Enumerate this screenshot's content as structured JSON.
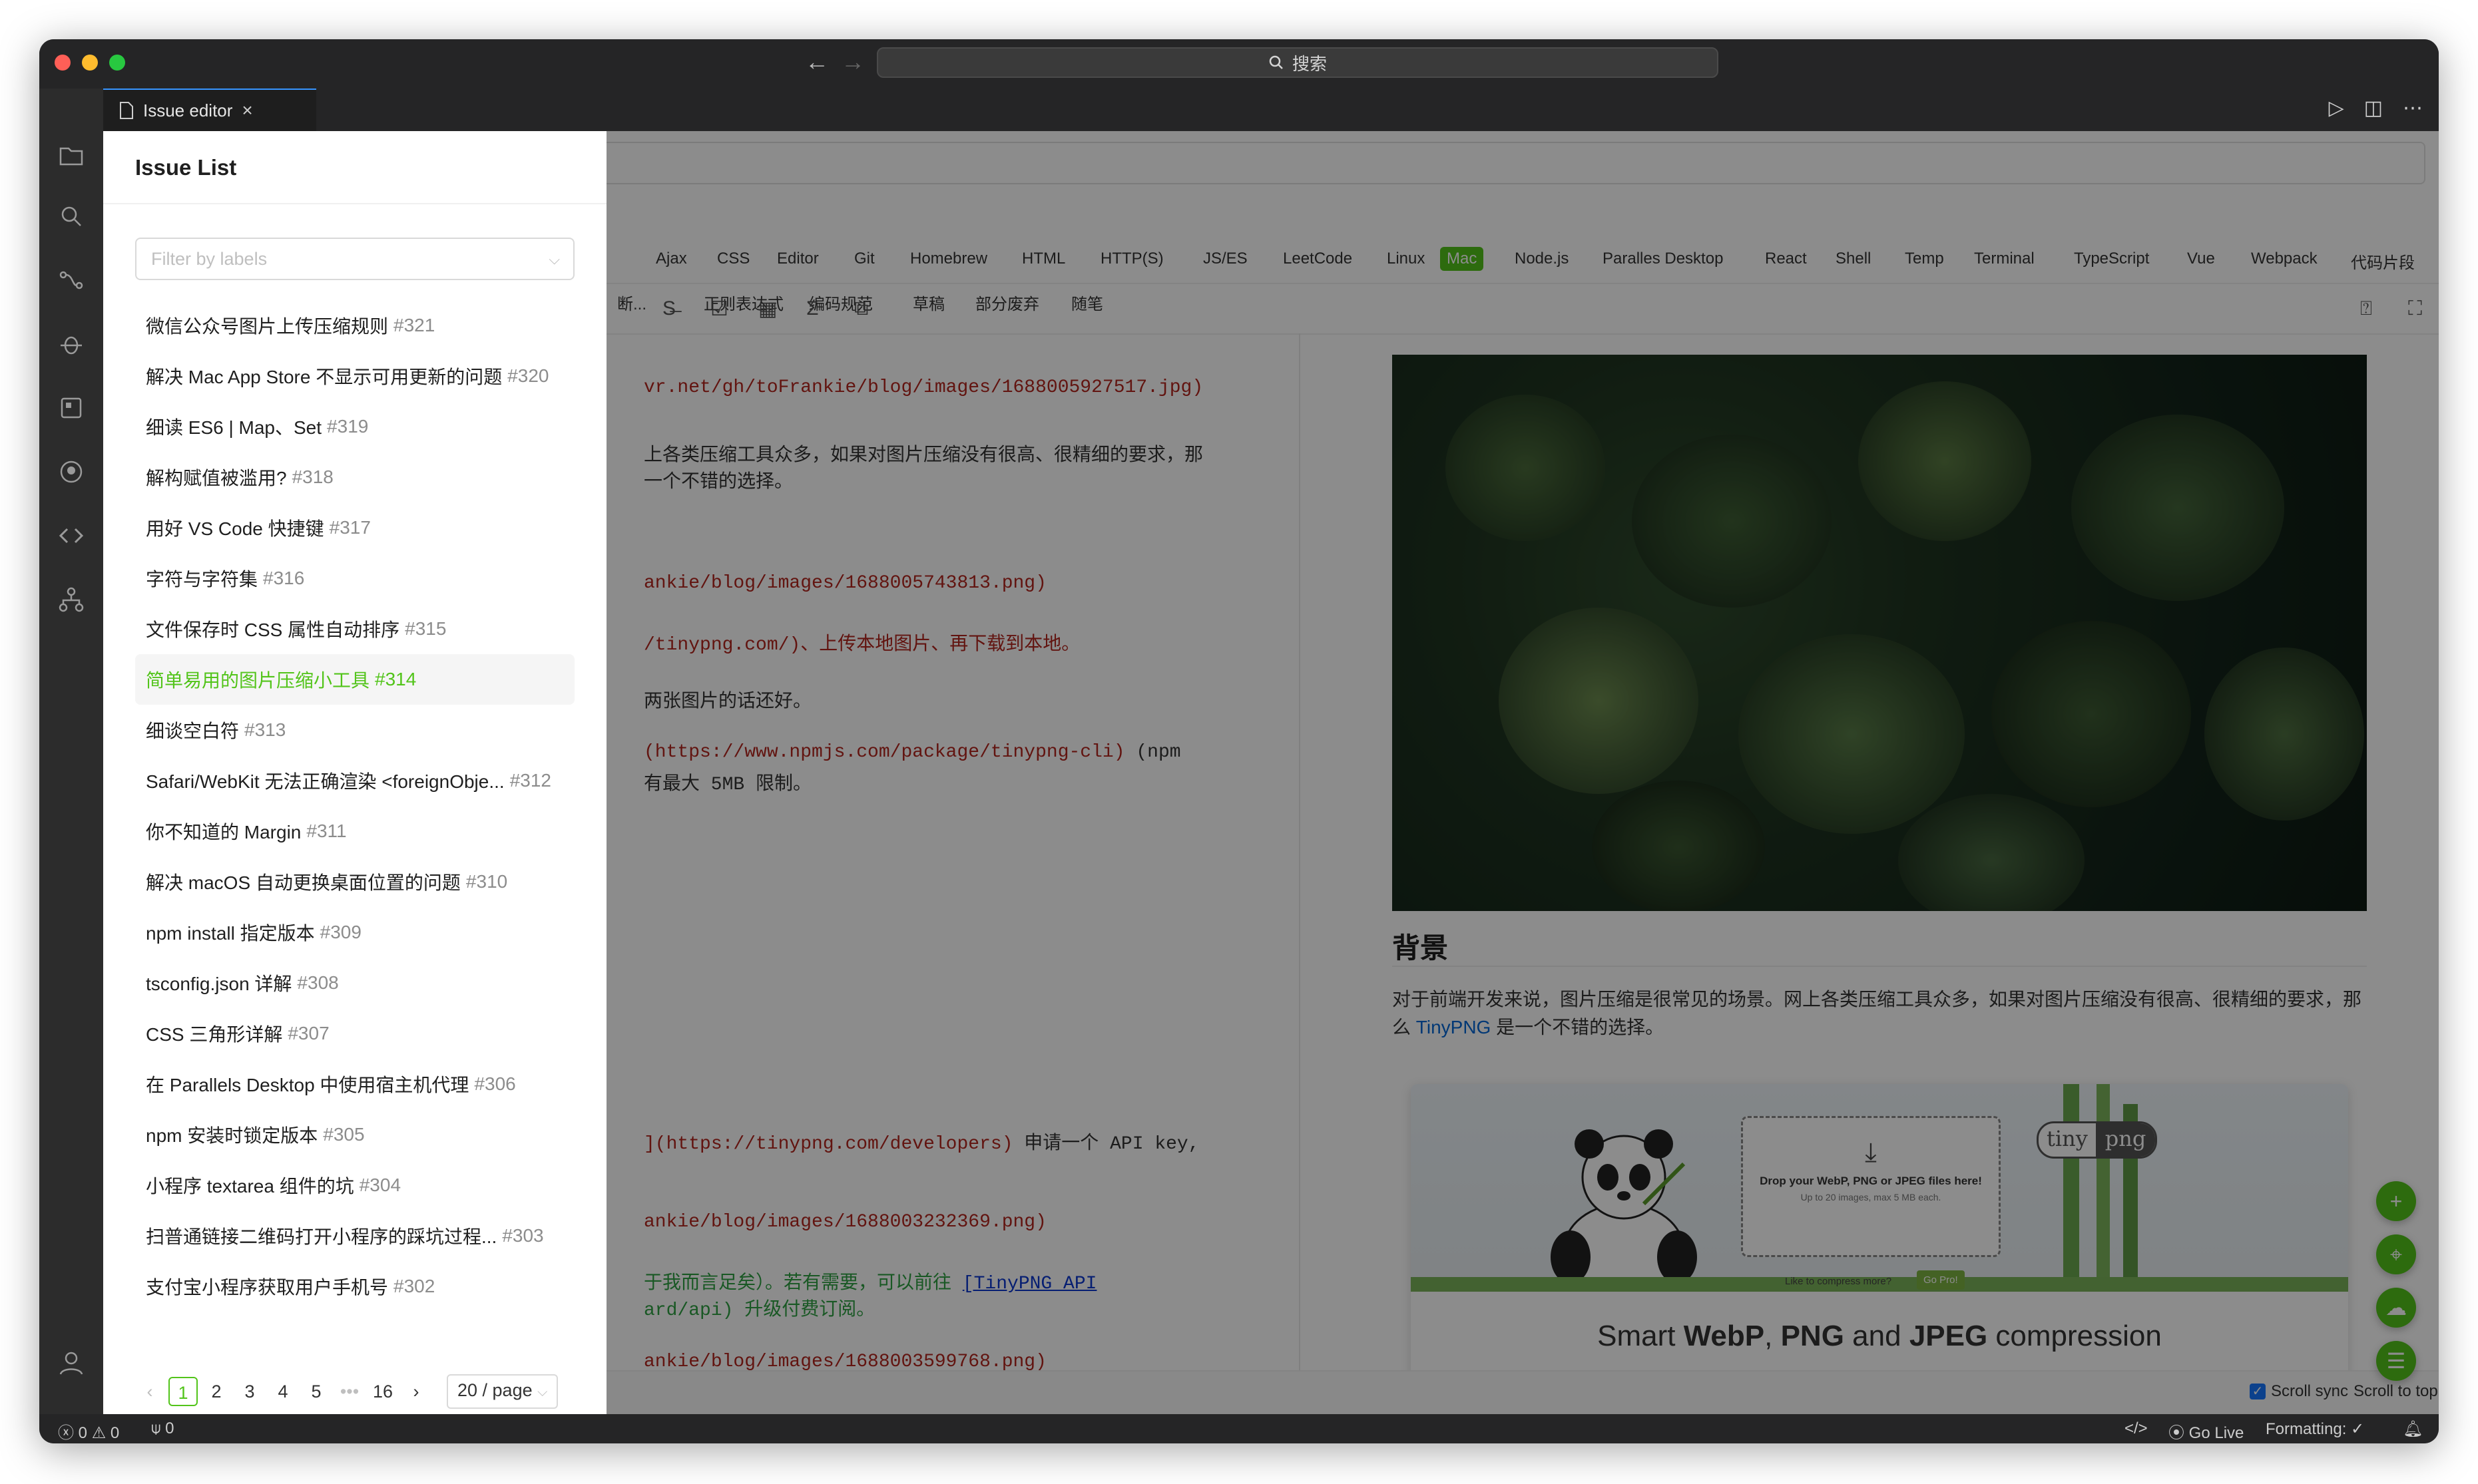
{
  "window": {
    "search_placeholder": "搜索"
  },
  "tab": {
    "label": "Issue editor"
  },
  "tags": [
    "Ajax",
    "CSS",
    "Editor",
    "Git",
    "Homebrew",
    "HTML",
    "HTTP(S)",
    "JS/ES",
    "LeetCode",
    "Linux",
    "Mac",
    "Node.js",
    "Paralles Desktop",
    "React",
    "Shell",
    "Temp",
    "Terminal",
    "TypeScript",
    "Vue",
    "Webpack",
    "代码片段"
  ],
  "tags_row2": [
    "断...",
    "正则表达式",
    "编码规范",
    "草稿",
    "部分废弃",
    "随笔"
  ],
  "active_tag": "Mac",
  "code_lines": {
    "l1": "vr.net/gh/toFrankie/blog/images/1688005927517.jpg)",
    "l2": "上各类压缩工具众多，如果对图片压缩没有很高、很精细的要求，那",
    "l3": "一个不错的选择。",
    "l4": "ankie/blog/images/1688005743813.png)",
    "l5": "/tinypng.com/)、上传本地图片、再下载到本地。",
    "l6": "两张图片的话还好。",
    "l7a": "(https://www.npmjs.com/package/tinypng-cli)",
    "l7b": " (npm",
    "l8": "有最大 5MB 限制。",
    "l9a": "](https://tinypng.com/developers)",
    "l9b": " 申请一个 API key,",
    "l10": "ankie/blog/images/1688003232369.png)",
    "l11a": "于我而言足矣）。若有需要，可以前往 ",
    "l11b": "[TinyPNG API ",
    "l12": "ard/api) 升级付费订阅。",
    "l13": "ankie/blog/images/1688003599768.png)"
  },
  "preview": {
    "heading": "背景",
    "para_part1": "对于前端开发来说，图片压缩是很常见的场景。网上各类压缩工具众多，如果对图片压缩没有很高、很精细的要求，那么 ",
    "para_link": "TinyPNG",
    "para_part2": " 是一个不错的选择。",
    "banner": {
      "drop_text": "Drop your WebP, PNG or JPEG files here!",
      "drop_sub": "Up to 20 images, max 5 MB each.",
      "compress_more": "Like to compress more?",
      "go_pro": "Go Pro!",
      "logo_left": "tiny",
      "logo_right": "png",
      "caption_prefix": "Smart ",
      "caption_webp": "WebP",
      "caption_mid1": ", ",
      "caption_png": "PNG",
      "caption_mid2": " and ",
      "caption_jpeg": "JPEG",
      "caption_suffix": " compression"
    }
  },
  "drawer": {
    "title": "Issue List",
    "filter_placeholder": "Filter by labels",
    "issues": [
      {
        "title": "微信公众号图片上传压缩规则",
        "num": "#321"
      },
      {
        "title": "解决 Mac App Store 不显示可用更新的问题",
        "num": "#320"
      },
      {
        "title": "细读 ES6 | Map、Set",
        "num": "#319"
      },
      {
        "title": "解构赋值被滥用?",
        "num": "#318"
      },
      {
        "title": "用好 VS Code 快捷键",
        "num": "#317"
      },
      {
        "title": "字符与字符集",
        "num": "#316"
      },
      {
        "title": "文件保存时 CSS 属性自动排序",
        "num": "#315"
      },
      {
        "title": "简单易用的图片压缩小工具",
        "num": "#314"
      },
      {
        "title": "细谈空白符",
        "num": "#313"
      },
      {
        "title": "Safari/WebKit 无法正确渲染 <foreignObje...",
        "num": "#312"
      },
      {
        "title": "你不知道的 Margin",
        "num": "#311"
      },
      {
        "title": "解决 macOS 自动更换桌面位置的问题",
        "num": "#310"
      },
      {
        "title": "npm install 指定版本",
        "num": "#309"
      },
      {
        "title": "tsconfig.json 详解",
        "num": "#308"
      },
      {
        "title": "CSS 三角形详解",
        "num": "#307"
      },
      {
        "title": "在 Parallels Desktop 中使用宿主机代理",
        "num": "#306"
      },
      {
        "title": "npm 安装时锁定版本",
        "num": "#305"
      },
      {
        "title": "小程序 textarea 组件的坑",
        "num": "#304"
      },
      {
        "title": "扫普通链接二维码打开小程序的踩坑过程...",
        "num": "#303"
      },
      {
        "title": "支付宝小程序获取用户手机号",
        "num": "#302"
      }
    ],
    "active_index": 7,
    "pagination": {
      "pages": [
        "1",
        "2",
        "3",
        "4",
        "5"
      ],
      "ellipsis": "•••",
      "last": "16",
      "current": "1",
      "page_size": "20 / page"
    }
  },
  "footer": {
    "scroll_sync": "Scroll sync",
    "scroll_top": "Scroll to top"
  },
  "status": {
    "errors": "0",
    "warnings": "0",
    "ports": "0",
    "go_live": "Go Live",
    "formatting": "Formatting: ✓"
  },
  "colors": {
    "accent": "#52c41a",
    "link": "#0366d6",
    "code_url": "#b3261e"
  }
}
